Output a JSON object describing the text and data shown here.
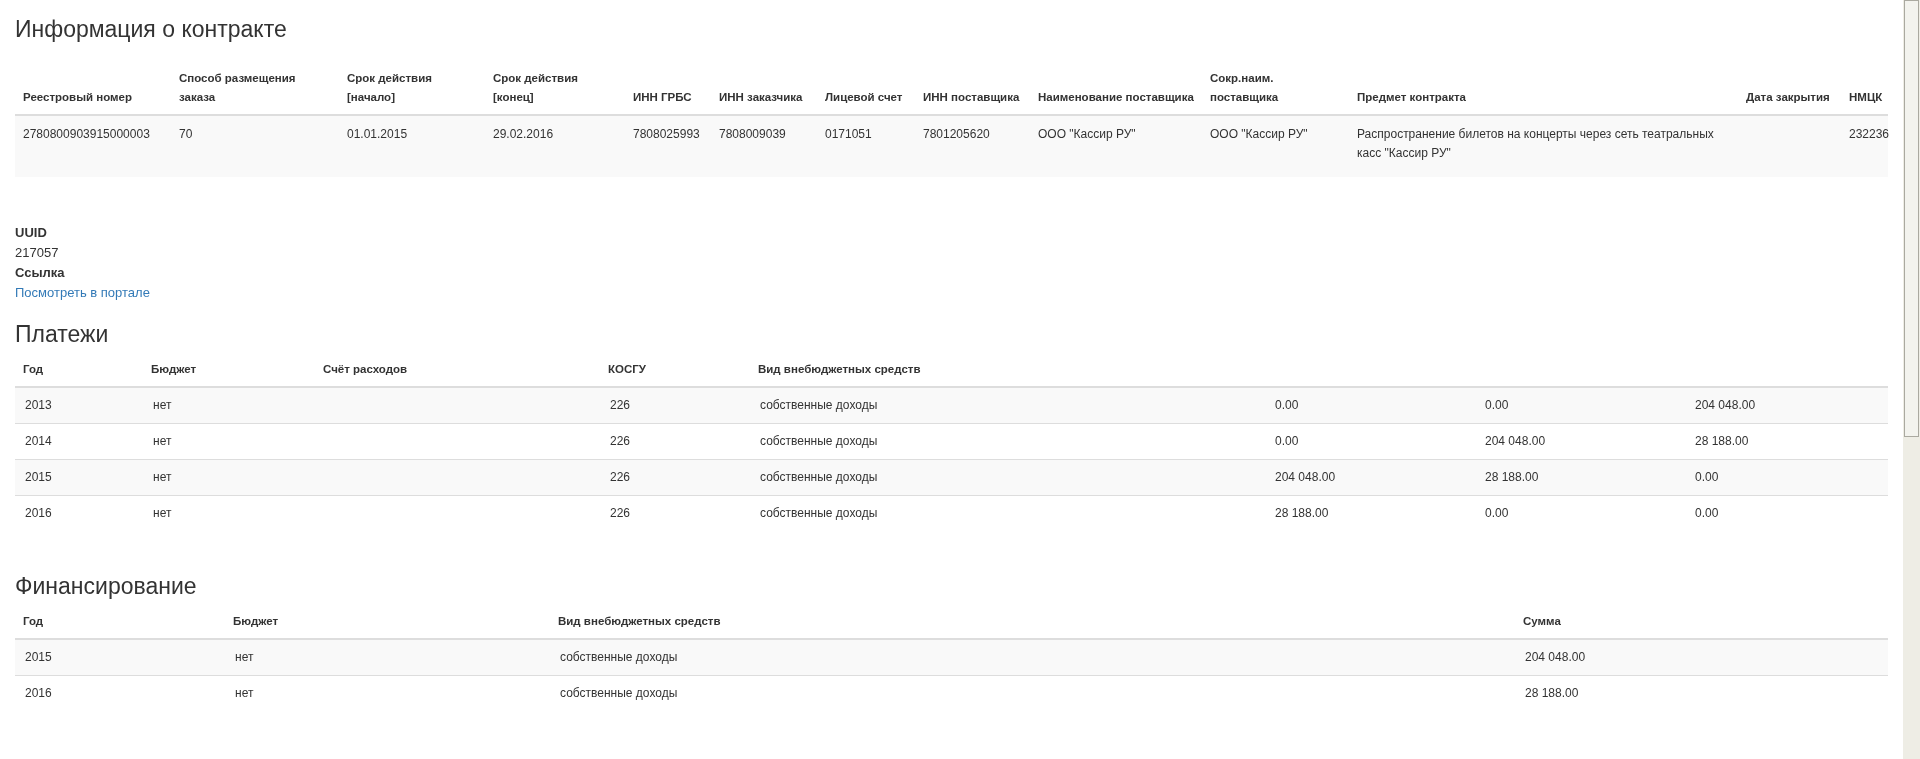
{
  "contract": {
    "title": "Информация о контракте",
    "columns": [
      "Реестровый номер",
      "Способ размещения заказа",
      "Срок действия [начало]",
      "Срок действия [конец]",
      "ИНН ГРБС",
      "ИНН заказчика",
      "Лицевой счет",
      "ИНН поставщика",
      "Наименование поставщика",
      "Сокр.наим. поставщика",
      "Предмет контракта",
      "Дата закрытия",
      "НМЦК"
    ],
    "rows": [
      [
        "2780800903915000003",
        "70",
        "01.01.2015",
        "29.02.2016",
        "7808025993",
        "7808009039",
        "0171051",
        "7801205620",
        "ООО \"Кассир РУ\"",
        "ООО \"Кассир РУ\"",
        "Распространение билетов на концерты через сеть театральных касс \"Кассир РУ\"",
        "",
        "232236"
      ]
    ]
  },
  "details": [
    {
      "label": "UUID",
      "value": "217057",
      "kind": "text"
    },
    {
      "label": "Ссылка",
      "value": "Посмотреть в портале",
      "kind": "link"
    }
  ],
  "payments": {
    "title": "Платежи",
    "columns": [
      "Год",
      "Бюджет",
      "Счёт расходов",
      "КОСГУ",
      "Вид внебюджетных средств"
    ],
    "rows": [
      [
        "2013",
        "нет",
        "",
        "226",
        "собственные доходы",
        "0.00",
        "0.00",
        "204 048.00"
      ],
      [
        "2014",
        "нет",
        "",
        "226",
        "собственные доходы",
        "0.00",
        "204 048.00",
        "28 188.00"
      ],
      [
        "2015",
        "нет",
        "",
        "226",
        "собственные доходы",
        "204 048.00",
        "28 188.00",
        "0.00"
      ],
      [
        "2016",
        "нет",
        "",
        "226",
        "собственные доходы",
        "28 188.00",
        "0.00",
        "0.00"
      ]
    ]
  },
  "financing": {
    "title": "Финансирование",
    "columns": [
      "Год",
      "Бюджет",
      "Вид внебюджетных средств",
      "Сумма"
    ],
    "rows": [
      [
        "2015",
        "нет",
        "собственные доходы",
        "204 048.00"
      ],
      [
        "2016",
        "нет",
        "собственные доходы",
        "28 188.00"
      ]
    ]
  }
}
